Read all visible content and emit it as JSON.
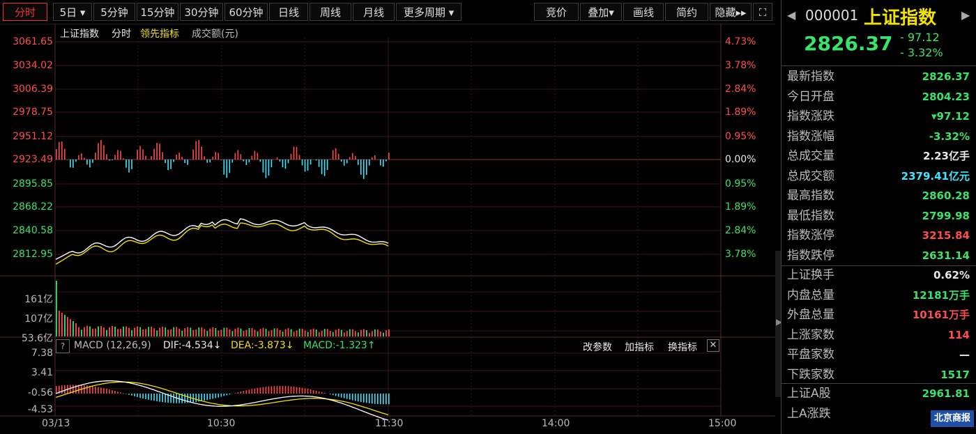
{
  "toolbar": {
    "periods": [
      "分时",
      "5日",
      "5分钟",
      "15分钟",
      "30分钟",
      "60分钟",
      "日线",
      "周线",
      "月线",
      "更多周期"
    ],
    "right": [
      "竞价",
      "叠加",
      "画线",
      "简约",
      "隐藏"
    ]
  },
  "legend": {
    "name": "上证指数",
    "mode": "分时",
    "lead": "领先指标",
    "vol": "成交额(元)"
  },
  "price_axis_left": [
    "3061.65",
    "3034.02",
    "3006.39",
    "2978.75",
    "2951.12",
    "2923.49",
    "2895.85",
    "2868.22",
    "2840.58",
    "2812.95"
  ],
  "pct_axis_right": [
    "4.73%",
    "3.78%",
    "2.84%",
    "1.89%",
    "0.95%",
    "0.00%",
    "0.95%",
    "1.89%",
    "2.84%",
    "3.78%"
  ],
  "volume_axis": [
    "161亿",
    "107亿",
    "53.6亿"
  ],
  "macd": {
    "help": "?",
    "title": "MACD (12,26,9)",
    "dif": "DIF:-4.534↓",
    "dea": "DEA:-3.873↓",
    "macd": "MACD:-1.323↑",
    "actions": [
      "改参数",
      "加指标",
      "换指标"
    ],
    "axis": [
      "7.38",
      "3.41",
      "-0.56",
      "-4.53"
    ]
  },
  "time_axis": [
    "03/13",
    "10:30",
    "11:30",
    "14:00",
    "15:00"
  ],
  "quote": {
    "code": "000001",
    "name": "上证指数",
    "price": "2826.37",
    "change": "- 97.12",
    "pct": "- 3.32%"
  },
  "stats": [
    {
      "k": "最新指数",
      "v": "2826.37",
      "c": "green"
    },
    {
      "k": "今日开盘",
      "v": "2804.23",
      "c": "green"
    },
    {
      "k": "指数涨跌",
      "v": "▾97.12",
      "c": "green"
    },
    {
      "k": "指数涨幅",
      "v": "-3.32%",
      "c": "green"
    },
    {
      "k": "总成交量",
      "v": "2.23亿手",
      "c": "white"
    },
    {
      "k": "总成交额",
      "v": "2379.41亿元",
      "c": "cyan"
    },
    {
      "k": "最高指数",
      "v": "2860.28",
      "c": "green"
    },
    {
      "k": "最低指数",
      "v": "2799.98",
      "c": "green"
    },
    {
      "k": "指数涨停",
      "v": "3215.84",
      "c": "red"
    },
    {
      "k": "指数跌停",
      "v": "2631.14",
      "c": "green"
    }
  ],
  "stats2": [
    {
      "k": "上证换手",
      "v": "0.62%",
      "c": "white"
    },
    {
      "k": "内盘总量",
      "v": "12181万手",
      "c": "green"
    },
    {
      "k": "外盘总量",
      "v": "10161万手",
      "c": "red"
    },
    {
      "k": "上涨家数",
      "v": "114",
      "c": "red"
    },
    {
      "k": "平盘家数",
      "v": "—",
      "c": "white"
    },
    {
      "k": "下跌家数",
      "v": "1517",
      "c": "green"
    }
  ],
  "stats3": [
    {
      "k": "上证A股",
      "v": "2961.81",
      "c": "green"
    },
    {
      "k": "上A涨跌",
      "v": "▾",
      "c": "green"
    }
  ],
  "watermark": "北京商报",
  "colors": {
    "up": "#ff4d4d",
    "down": "#39e36a",
    "price_line": "#ffffff",
    "avg_line": "#f2e200",
    "macd_neg": "#3fe6ff"
  }
}
